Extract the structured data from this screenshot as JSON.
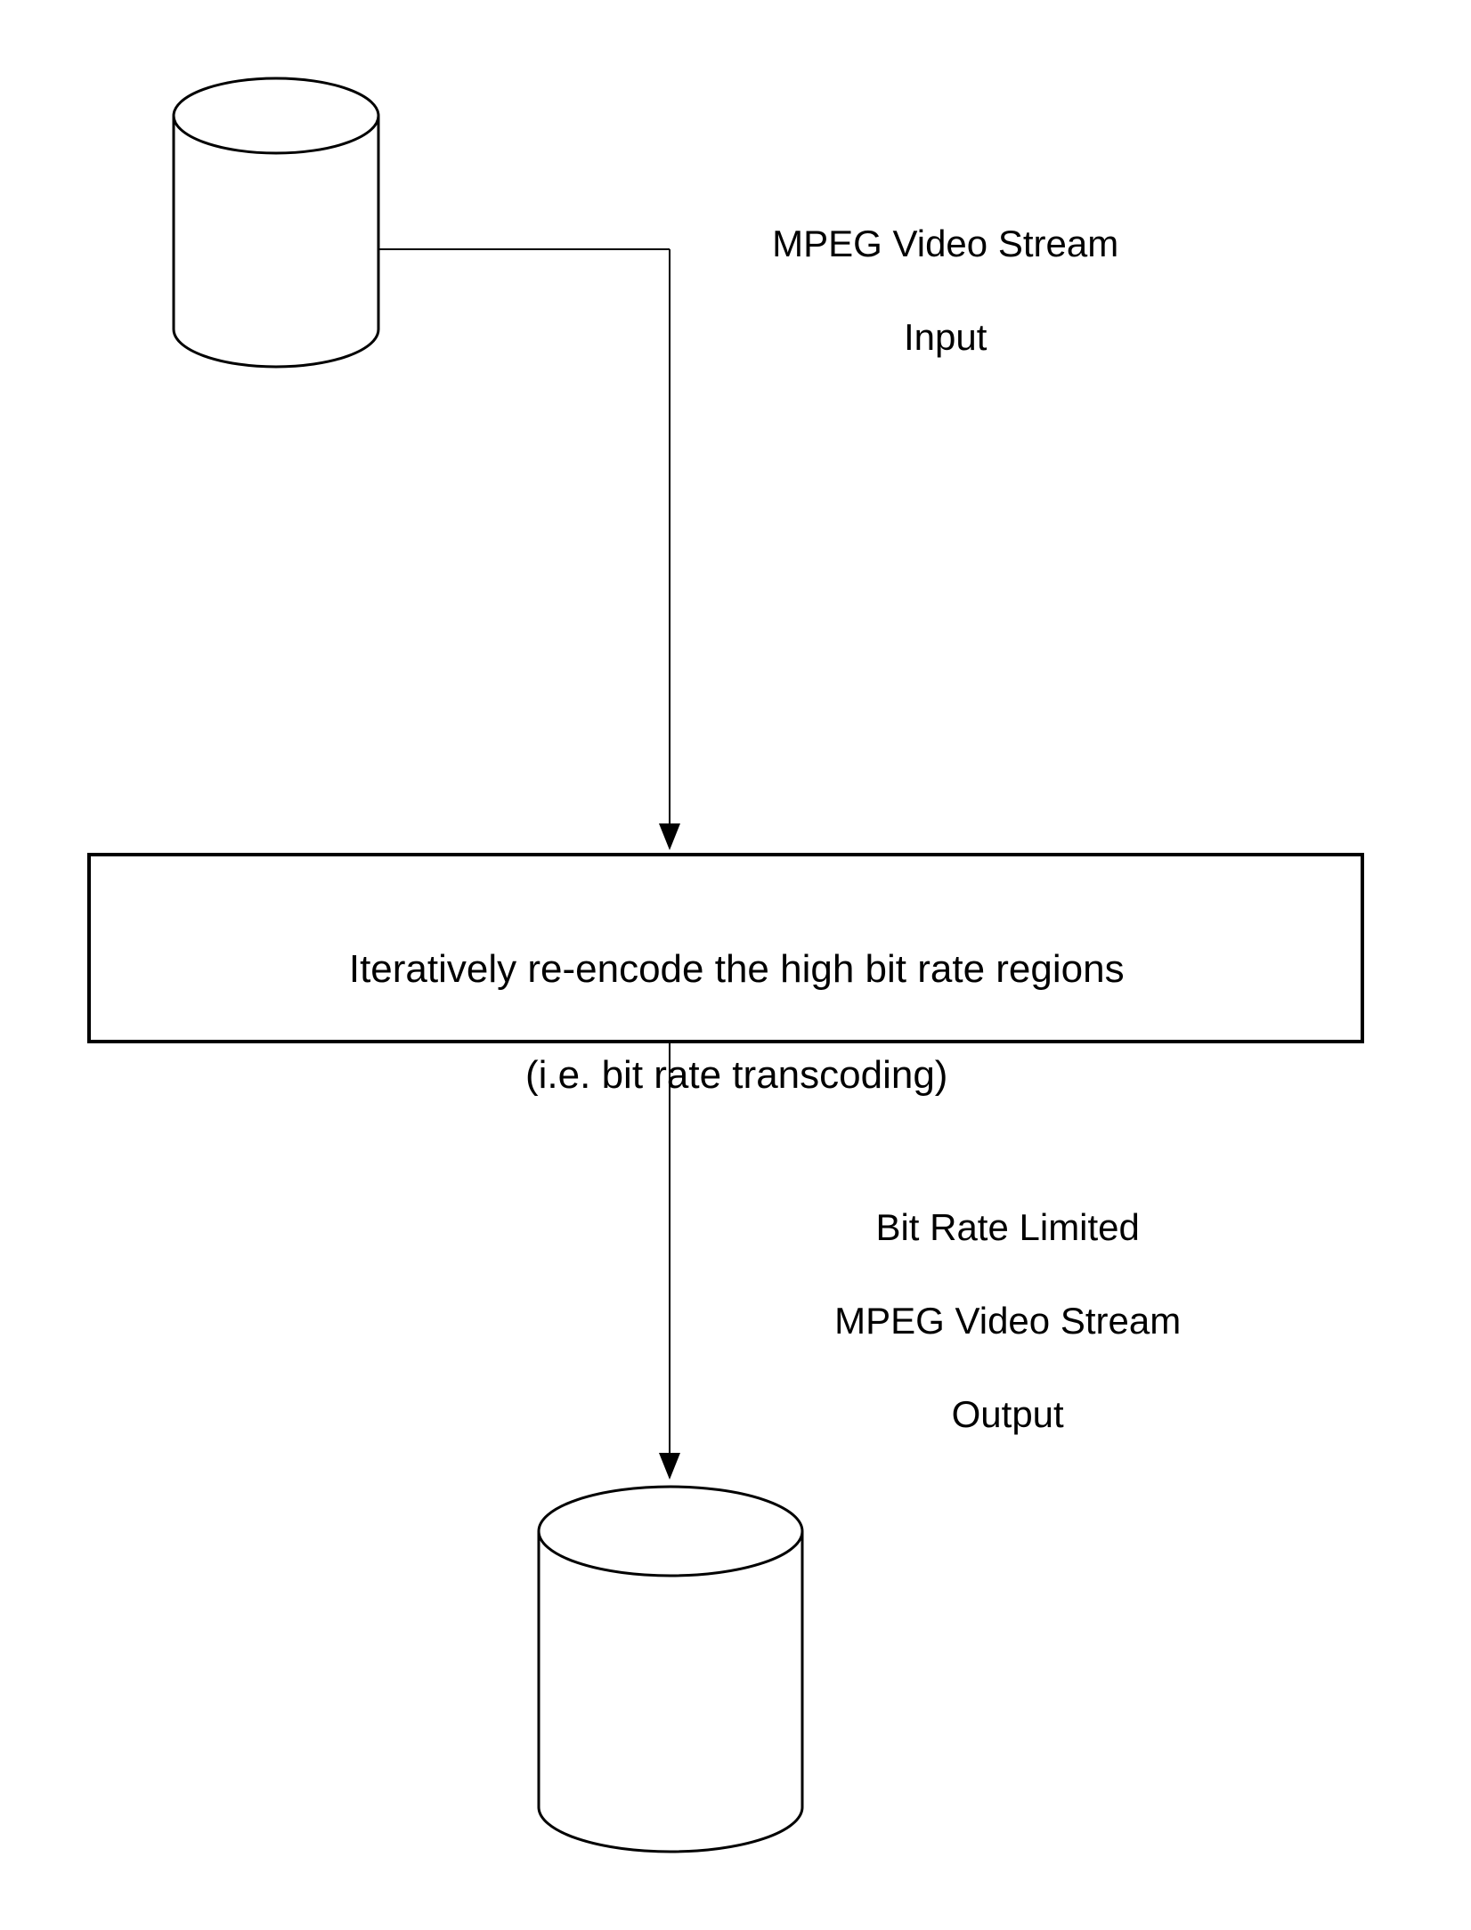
{
  "diagram": {
    "input_label_line1": "MPEG Video Stream",
    "input_label_line2": "Input",
    "process_line1": "Iteratively re-encode the high bit rate regions",
    "process_line2": "(i.e. bit rate transcoding)",
    "output_label_line1": "Bit Rate Limited",
    "output_label_line2": "MPEG Video Stream",
    "output_label_line3": "Output"
  }
}
